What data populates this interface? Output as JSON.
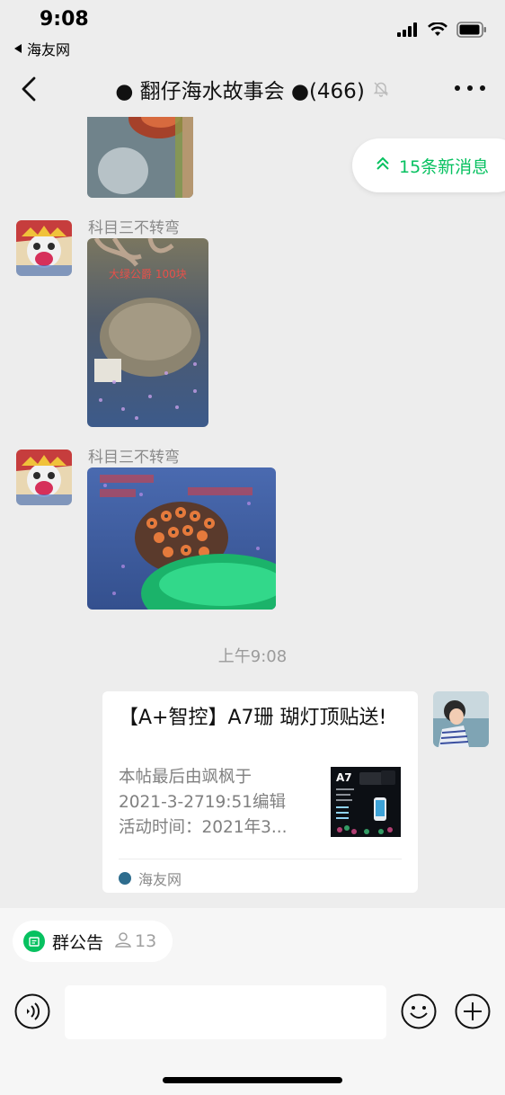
{
  "status_bar": {
    "time": "9:08",
    "back_app": "海友网"
  },
  "nav": {
    "title": "● 翻仔海水故事会 ●(466)"
  },
  "chat": {
    "new_messages_pill": "15条新消息",
    "messages": [
      {
        "sender": "科目三不转弯",
        "image_caption": "大绿公爵 100块"
      },
      {
        "sender": "科目三不转弯"
      }
    ],
    "timestamp": "上午9:08",
    "link_card": {
      "title": "【A+智控】A7珊 瑚灯顶贴送!",
      "desc_lines": [
        "本帖最后由飒枫于",
        "2021-3-2719:51编辑",
        "活动时间：2021年3..."
      ],
      "thumb_label": "A7",
      "source": "海友网"
    }
  },
  "bottom": {
    "notice_label": "群公告",
    "notice_count": "13",
    "input_placeholder": ""
  },
  "colors": {
    "accent_green": "#07c160",
    "background": "#ededed"
  }
}
